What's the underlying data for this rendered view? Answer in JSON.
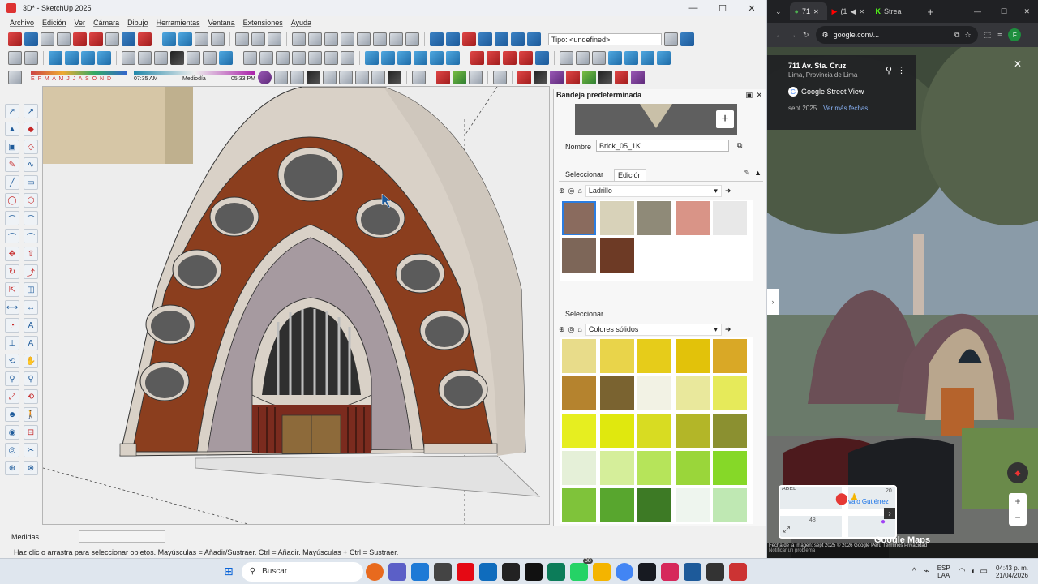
{
  "sketchup": {
    "title": "3D* - SketchUp 2025",
    "menu": [
      "Archivo",
      "Edición",
      "Ver",
      "Cámara",
      "Dibujo",
      "Herramientas",
      "Ventana",
      "Extensiones",
      "Ayuda"
    ],
    "tag_field": "Tipo: <undefined>",
    "shadow_months": "E F M A M J J A S O N D",
    "shadow_time_start": "07:35 AM",
    "shadow_time_mid": "Mediodía",
    "shadow_time_end": "05:33 PM",
    "tray": {
      "title": "Bandeja predeterminada",
      "name_label": "Nombre",
      "name_value": "Brick_05_1K",
      "tab_select": "Seleccionar",
      "tab_edit": "Edición",
      "library1": "Ladrillo",
      "section2_label": "Seleccionar",
      "library2": "Colores sólidos"
    },
    "status": {
      "measures_label": "Medidas",
      "hint": "Haz clic o arrastra para seleccionar objetos. Mayúsculas = Añadir/Sustraer. Ctrl = Añadir. Mayúsculas + Ctrl = Sustraer."
    },
    "colors": {
      "brick": "#8b3e1e",
      "stone": "#a69aa0",
      "wall": "#d8d2c8",
      "accent": "#1d5a9a"
    }
  },
  "chrome": {
    "tabs": [
      {
        "label": "71"
      },
      {
        "label": "(1"
      },
      {
        "label": "Strea"
      }
    ],
    "url": "google.com/...",
    "profile_initial": "F",
    "address": "711 Av. Sta. Cruz",
    "city": "Lima, Provincia de Lima",
    "source": "Google Street View",
    "date": "sept 2025",
    "more_dates": "Ver más fechas",
    "minimap_label_1": "ABEL",
    "minimap_label_2": "valo Gutiérrez",
    "minimap_num_1": "20",
    "minimap_num_2": "48",
    "brand": "Google Maps",
    "footer": "Fecha de la imagen: sept 2025    © 2026 Google    Perú    Términos    Privacidad",
    "report": "Notificar un problema"
  },
  "taskbar": {
    "search": "Buscar",
    "lang1": "ESP",
    "lang2": "LAA",
    "time": "04:43 p. m.",
    "date": "21/04/2026",
    "badge": "38"
  }
}
